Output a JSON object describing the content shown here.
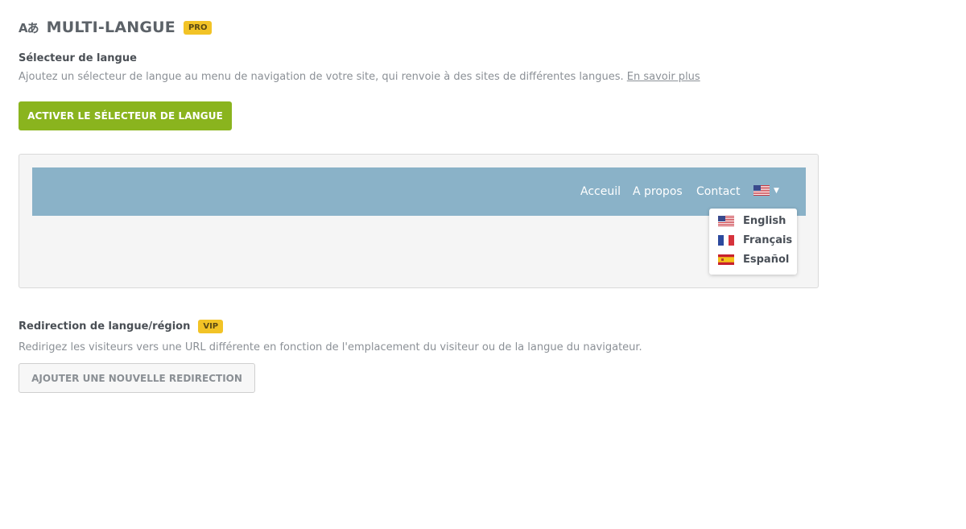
{
  "header": {
    "icon": "translate-icon",
    "icon_glyph": "Aあ",
    "title": "MULTI-LANGUE",
    "badge": "PRO"
  },
  "language_selector": {
    "title": "Sélecteur de langue",
    "description": "Ajoutez un sélecteur de langue au menu de navigation de votre site, qui renvoie à des sites de différentes langues.",
    "learn_more": "En savoir plus",
    "button_label": "ACTIVER LE SÉLECTEUR DE LANGUE"
  },
  "preview": {
    "nav_items": [
      "Acceuil",
      "A propos",
      "Contact"
    ],
    "current_flag": "us-flag-icon",
    "dropdown": [
      {
        "label": "English",
        "flag": "us-flag-icon"
      },
      {
        "label": "Français",
        "flag": "fr-flag-icon"
      },
      {
        "label": "Español",
        "flag": "es-flag-icon"
      }
    ]
  },
  "redirection": {
    "title": "Redirection de langue/région",
    "badge": "VIP",
    "description": "Redirigez les visiteurs vers une URL différente en fonction de l'emplacement du visiteur ou de la langue du navigateur.",
    "button_label": "AJOUTER UNE NOUVELLE REDIRECTION"
  },
  "colors": {
    "primary_button": "#8ab41e",
    "badge": "#f2c326",
    "navbar": "#8ab2c8"
  }
}
